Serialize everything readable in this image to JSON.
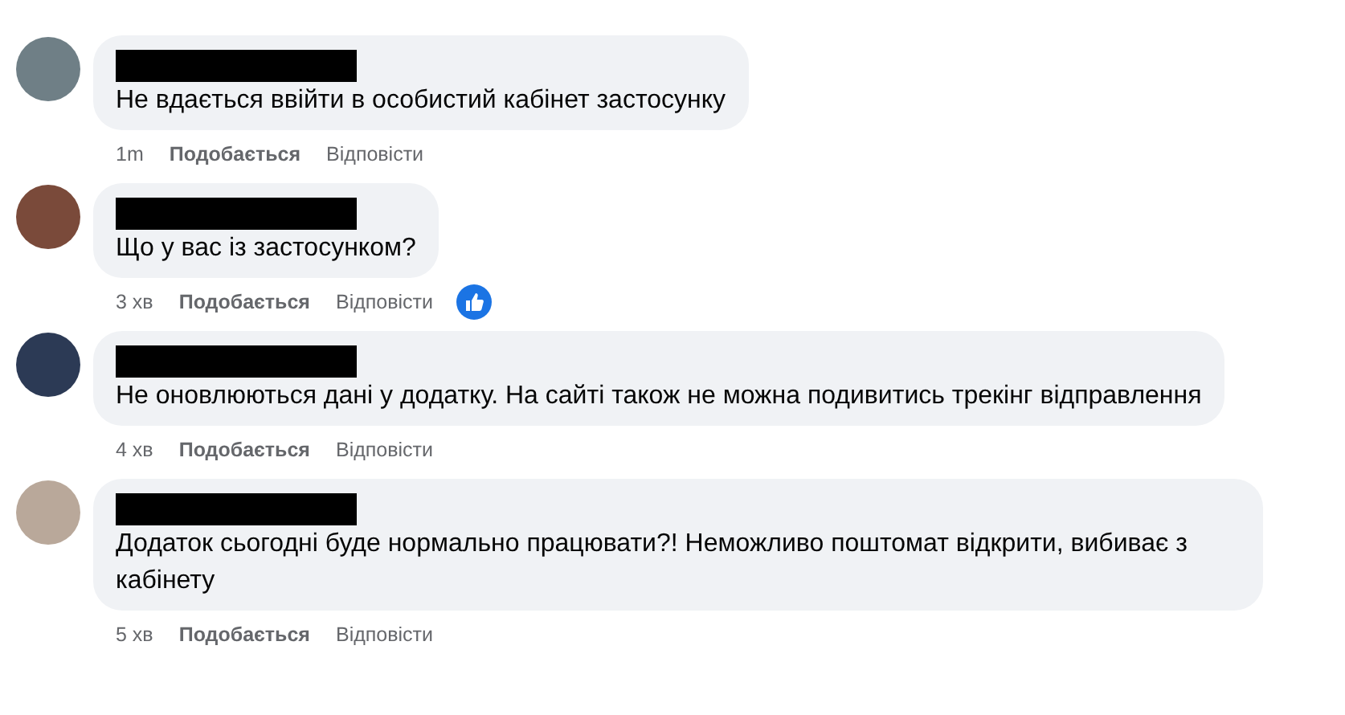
{
  "comments": [
    {
      "text": "Не вдається ввійти в особистий кабінет застосунку",
      "time": "1m",
      "like_label": "Подобається",
      "reply_label": "Відповісти",
      "like_reaction": false
    },
    {
      "text": "Що у вас із застосунком?",
      "time": "3 хв",
      "like_label": "Подобається",
      "reply_label": "Відповісти",
      "like_reaction": true
    },
    {
      "text": "Не оновлюються дані у додатку. На сайті також не можна подивитись трекінг відправлення",
      "time": "4 хв",
      "like_label": "Подобається",
      "reply_label": "Відповісти",
      "like_reaction": false
    },
    {
      "text": "Додаток сьогодні буде нормально працювати?! Неможливо поштомат відкрити, вибиває з кабінету",
      "time": "5 хв",
      "like_label": "Подобається",
      "reply_label": "Відповісти",
      "like_reaction": false
    }
  ]
}
